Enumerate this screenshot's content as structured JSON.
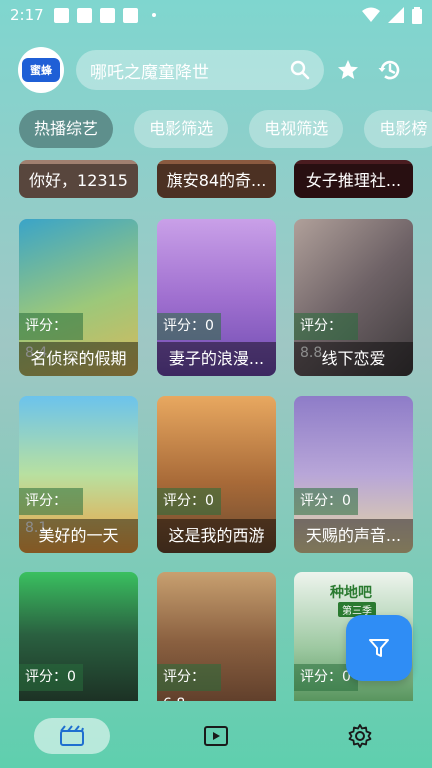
{
  "status_bar": {
    "time": "2:17"
  },
  "header": {
    "logo_text": "蜜蜂",
    "search_text": "哪吒之魔童降世",
    "icons": [
      "search-icon",
      "star-icon",
      "history-icon"
    ]
  },
  "chips": [
    {
      "label": "热播综艺",
      "active": true
    },
    {
      "label": "电影筛选",
      "active": false
    },
    {
      "label": "电视筛选",
      "active": false
    },
    {
      "label": "电影榜",
      "active": false
    }
  ],
  "rows": {
    "row0": [
      {
        "title": "你好，12315",
        "score": ""
      },
      {
        "title": "旗安84的奇...",
        "score": ""
      },
      {
        "title": "女子推理社...",
        "score": ""
      }
    ],
    "row1": [
      {
        "title": "名侦探的假期",
        "score": "评分：8.4",
        "c1": "#3aa4c8",
        "c2": "#d9b85c"
      },
      {
        "title": "妻子的浪漫...",
        "score": "评分：0",
        "c1": "#c9a0e8",
        "c2": "#6e4bb0"
      },
      {
        "title": "线下恋爱",
        "score": "评分：8.8",
        "c1": "#b0a09a",
        "c2": "#3e3a3c"
      }
    ],
    "row2": [
      {
        "title": "美好的一天",
        "score": "评分：8.1",
        "c1": "#6cc3ec",
        "c2": "#f0a040"
      },
      {
        "title": "这是我的西游",
        "score": "评分：0",
        "c1": "#e8a860",
        "c2": "#6b4a30"
      },
      {
        "title": "天赐的声音...",
        "score": "评分：0",
        "c1": "#8e7cc8",
        "c2": "#e6d7a0"
      }
    ],
    "row3": [
      {
        "title": "",
        "score": "评分：0",
        "c1": "#3ac060",
        "c2": "#1a2a20"
      },
      {
        "title": "",
        "score": "评分：6.8",
        "c1": "#c8a070",
        "c2": "#5a3a28"
      },
      {
        "title": "",
        "score": "评分：0",
        "c1": "#eef4ee",
        "c2": "#4a8a50"
      }
    ]
  },
  "row3_badges": {
    "left": "种地吧",
    "right": "第三季"
  },
  "bottom_nav": [
    "movie-icon",
    "play-icon",
    "settings-icon"
  ]
}
